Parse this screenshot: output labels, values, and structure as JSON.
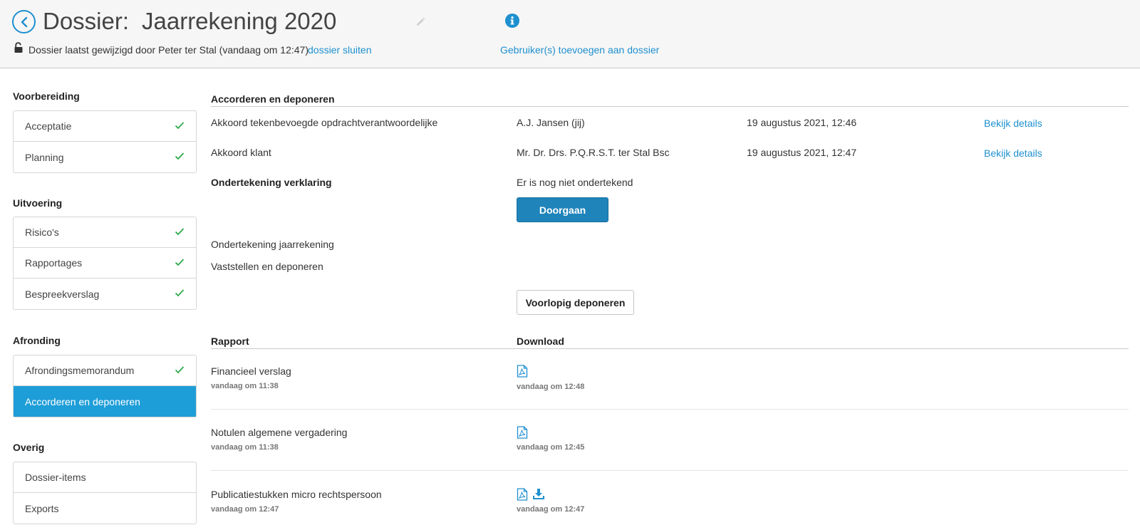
{
  "header": {
    "title_prefix": "Dossier:",
    "title_name": "Jaarrekening 2020",
    "modified_text": "Dossier laatst gewijzigd door Peter ter Stal (vandaag om 12:47)",
    "close_link": "dossier sluiten",
    "add_users_link": "Gebruiker(s) toevoegen aan dossier"
  },
  "sidebar": {
    "sections": [
      {
        "title": "Voorbereiding",
        "items": [
          {
            "label": "Acceptatie",
            "done": true
          },
          {
            "label": "Planning",
            "done": true
          }
        ]
      },
      {
        "title": "Uitvoering",
        "items": [
          {
            "label": "Risico's",
            "done": true
          },
          {
            "label": "Rapportages",
            "done": true
          },
          {
            "label": "Bespreekverslag",
            "done": true
          }
        ]
      },
      {
        "title": "Afronding",
        "items": [
          {
            "label": "Afrondingsmemorandum",
            "done": true
          },
          {
            "label": "Accorderen en deponeren",
            "active": true
          }
        ]
      },
      {
        "title": "Overig",
        "items": [
          {
            "label": "Dossier-items"
          },
          {
            "label": "Exports"
          }
        ]
      }
    ]
  },
  "approve": {
    "heading": "Accorderen en deponeren",
    "rows": [
      {
        "label": "Akkoord tekenbevoegde opdrachtverantwoordelijke",
        "person": "A.J. Jansen (jij)",
        "date": "19 augustus 2021, 12:46",
        "link": "Bekijk details"
      },
      {
        "label": "Akkoord klant",
        "person": "Mr. Dr. Drs. P.Q.R.S.T. ter Stal Bsc",
        "date": "19 augustus 2021, 12:47",
        "link": "Bekijk details"
      }
    ],
    "sign_label": "Ondertekening verklaring",
    "sign_status": "Er is nog niet ondertekend",
    "continue_button": "Doorgaan",
    "sign_annual": "Ondertekening jaarrekening",
    "establish": "Vaststellen en deponeren",
    "deposit_button": "Voorlopig deponeren"
  },
  "reports": {
    "col_report": "Rapport",
    "col_download": "Download",
    "rows": [
      {
        "name": "Financieel verslag",
        "created": "vandaag om 11:38",
        "download_time": "vandaag om 12:48",
        "download_icon": false
      },
      {
        "name": "Notulen algemene vergadering",
        "created": "vandaag om 11:38",
        "download_time": "vandaag om 12:45",
        "download_icon": false
      },
      {
        "name": "Publicatiestukken micro rechtspersoon",
        "created": "vandaag om 12:47",
        "download_time": "vandaag om 12:47",
        "download_icon": true
      }
    ]
  },
  "colors": {
    "accent": "#1e9ed8",
    "link": "#1e90cf",
    "check": "#2ea84a",
    "primary_button": "#1f84ba"
  }
}
